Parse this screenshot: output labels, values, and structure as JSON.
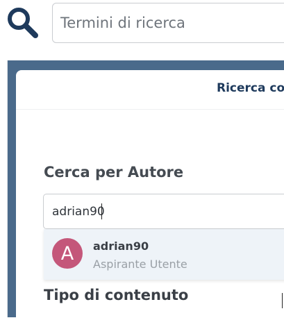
{
  "search": {
    "placeholder": "Termini di ricerca",
    "value": ""
  },
  "panel": {
    "tab_label": "Ricerca co"
  },
  "author_filter": {
    "label": "Cerca per Autore",
    "value": "adrian90"
  },
  "suggestion": {
    "avatar_letter": "A",
    "avatar_color": "#c4577a",
    "username": "adrian90",
    "role": "Aspirante Utente"
  },
  "content_type": {
    "label": "Tipo di contenuto"
  },
  "colors": {
    "brand": "#1e3a5c",
    "panel_border": "#4a6a8b",
    "suggestion_bg": "#eef3f8"
  },
  "icons": {
    "search": "search-icon"
  }
}
